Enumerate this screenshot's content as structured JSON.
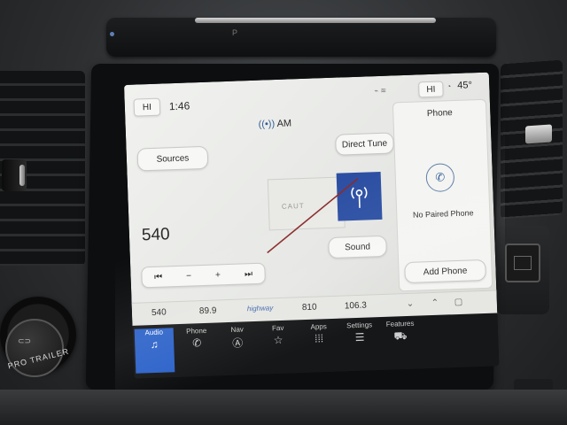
{
  "status": {
    "climate_left": "HI",
    "time": "1:46",
    "climate_right": "HI",
    "outside_temp": "45°"
  },
  "audio": {
    "band": "AM",
    "sources_label": "Sources",
    "direct_tune_label": "Direct Tune",
    "frequency": "540",
    "sound_label": "Sound",
    "art_text": "CAUT",
    "station_logo": "highway"
  },
  "transport": {
    "prev": "⏮",
    "minus": "−",
    "plus": "+",
    "next": "⏭"
  },
  "phone": {
    "title": "Phone",
    "status": "No Paired Phone",
    "add_label": "Add Phone"
  },
  "presets": [
    "540",
    "89.9",
    "",
    "810",
    "106.3"
  ],
  "nav": [
    {
      "label": "Audio",
      "icon": "music-note-icon"
    },
    {
      "label": "Phone",
      "icon": "phone-icon"
    },
    {
      "label": "Nav",
      "icon": "navigation-icon"
    },
    {
      "label": "Fav",
      "icon": "star-icon"
    },
    {
      "label": "Apps",
      "icon": "grid-icon"
    },
    {
      "label": "Settings",
      "icon": "sliders-icon"
    },
    {
      "label": "Features",
      "icon": "car-icon"
    }
  ],
  "hardware": {
    "knob_label": "PRO TRAILER",
    "trim_button": "P"
  },
  "colors": {
    "accent": "#2d63c9",
    "album_art": "#2c4fa3"
  }
}
